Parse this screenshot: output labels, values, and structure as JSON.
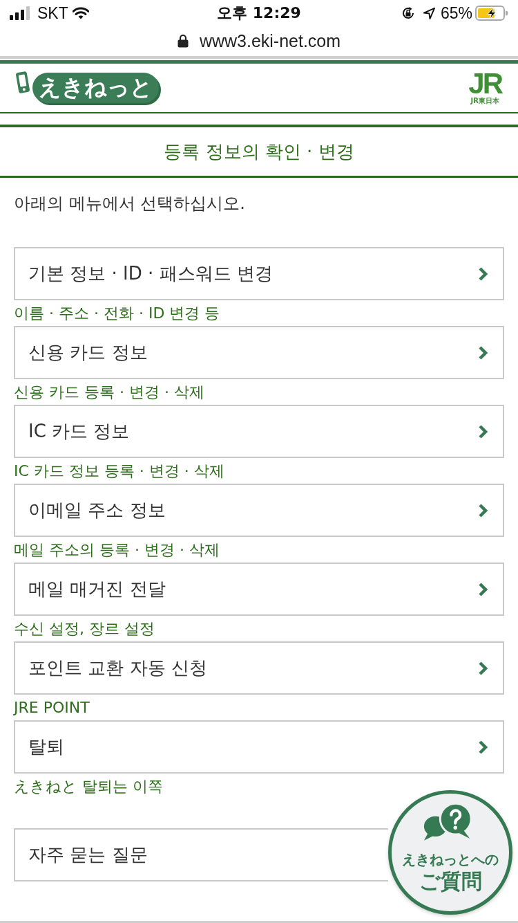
{
  "status_bar": {
    "carrier": "SKT",
    "time": "오후 12:29",
    "battery": "65%"
  },
  "browser": {
    "url": "www3.eki-net.com"
  },
  "header": {
    "logo": "えきねっと",
    "jr_logo": "JR",
    "jr_subtitle": "JR東日本"
  },
  "page_title": "등록 정보의 확인 · 변경",
  "instruction": "아래의 메뉴에서 선택하십시오.",
  "menu": [
    {
      "label": "기본 정보 · ID · 패스워드 변경",
      "caption": "이름 · 주소 · 전화 · ID 변경 등"
    },
    {
      "label": "신용 카드 정보",
      "caption": "신용 카드 등록 · 변경 · 삭제"
    },
    {
      "label": "IC 카드 정보",
      "caption": "IC 카드 정보 등록 · 변경 · 삭제"
    },
    {
      "label": "이메일 주소 정보",
      "caption": "메일 주소의 등록 · 변경 · 삭제"
    },
    {
      "label": "메일 매거진 전달",
      "caption": "수신 설정, 장르 설정"
    },
    {
      "label": "포인트 교환 자동 신청",
      "caption": "JRE POINT"
    },
    {
      "label": "탈퇴",
      "caption": "えきねと 탈퇴는 이쪽"
    }
  ],
  "faq": {
    "label": "자주 묻는 질문"
  },
  "help_bubble": {
    "line1": "えきねっとへの",
    "line2": "ご質問"
  }
}
